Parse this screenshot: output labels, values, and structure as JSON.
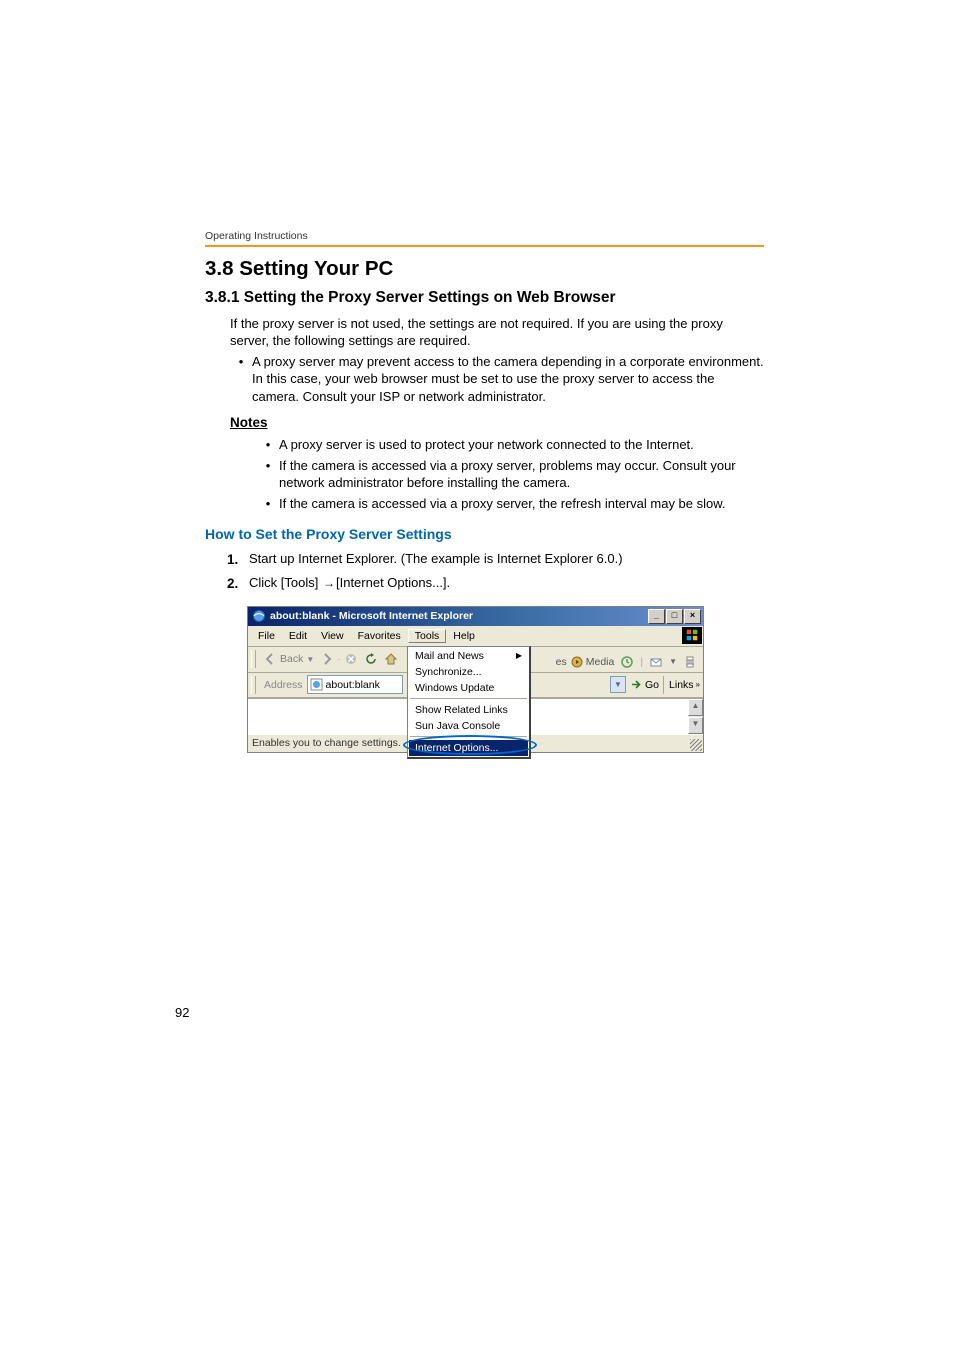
{
  "header": {
    "running": "Operating Instructions"
  },
  "section": {
    "num_title": "3.8   Setting Your PC",
    "sub_num_title": "3.8.1   Setting the Proxy Server Settings on Web Browser",
    "intro": "If the proxy server is not used, the settings are not required. If you are using the proxy server, the following settings are required.",
    "bullets": [
      "A proxy server may prevent access to the camera depending in a corporate environment. In this case, your web browser must be set to use the proxy server to access the camera. Consult your ISP or network administrator."
    ],
    "notes_title": "Notes",
    "notes": [
      "A proxy server is used to protect your network connected to the Internet.",
      "If the camera is accessed via a proxy server, problems may occur. Consult your network administrator before installing the camera.",
      "If the camera is accessed via a proxy server, the refresh interval may be slow."
    ],
    "howto_title": "How to Set the Proxy Server Settings",
    "steps": [
      {
        "n": "1.",
        "text": "Start up Internet Explorer. (The example is Internet Explorer 6.0.)"
      },
      {
        "n": "2.",
        "pre": "Click [Tools]",
        "arrow": "→",
        "post": "[Internet Options...]."
      }
    ]
  },
  "ie": {
    "title": "about:blank - Microsoft Internet Explorer",
    "menu": {
      "file": "File",
      "edit": "Edit",
      "view": "View",
      "favorites": "Favorites",
      "tools": "Tools",
      "help": "Help"
    },
    "toolbar": {
      "back": "Back",
      "media": "Media",
      "es_fragment": "es"
    },
    "address": {
      "label": "Address",
      "value": "about:blank",
      "go": "Go",
      "links": "Links"
    },
    "tools_menu": {
      "mail": "Mail and News",
      "sync": "Synchronize...",
      "wupdate": "Windows Update",
      "related": "Show Related Links",
      "java": "Sun Java Console",
      "iopts": "Internet Options..."
    },
    "status": "Enables you to change settings."
  },
  "page_number": "92"
}
